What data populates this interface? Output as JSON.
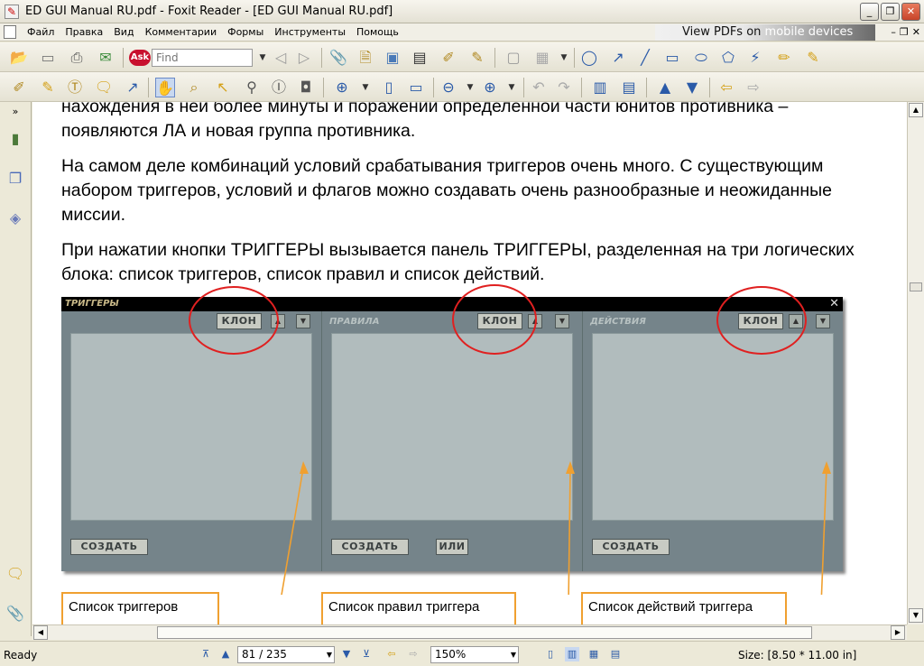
{
  "window": {
    "title": "ED GUI Manual RU.pdf - Foxit Reader - [ED GUI Manual RU.pdf]"
  },
  "menu": {
    "items": [
      "Файл",
      "Правка",
      "Вид",
      "Комментарии",
      "Формы",
      "Инструменты",
      "Помощь"
    ]
  },
  "ad": {
    "text_a": "View PDFs on ",
    "text_b": "mobile devices"
  },
  "toolbar": {
    "find_placeholder": "Find",
    "ask_label": "Ask"
  },
  "document": {
    "paragraphs": [
      "нахождения в ней более минуты и поражении определенной части юнитов противника – появляются ЛА и новая группа противника.",
      "На самом деле комбинаций условий срабатывания триггеров очень много. С существующим набором триггеров, условий и флагов можно создавать очень разнообразные и неожиданные миссии.",
      "При нажатии кнопки ТРИГГЕРЫ вызывается панель ТРИГГЕРЫ, разделенная на три логических блока: список триггеров, список правил и список действий."
    ],
    "panel": {
      "title": "ТРИГГЕРЫ",
      "close": "✕",
      "columns": [
        {
          "title": "",
          "clone": "КЛОН",
          "create": "СОЗДАТЬ",
          "extra": ""
        },
        {
          "title": "ПРАВИЛА",
          "clone": "КЛОН",
          "create": "СОЗДАТЬ",
          "extra": "ИЛИ"
        },
        {
          "title": "ДЕЙСТВИЯ",
          "clone": "КЛОН",
          "create": "СОЗДАТЬ",
          "extra": ""
        }
      ]
    },
    "callouts": [
      "Список триггеров",
      "Список правил триггера",
      "Список действий триггера"
    ]
  },
  "status": {
    "ready": "Ready",
    "page": "81 / 235",
    "zoom": "150%",
    "size": "Size: [8.50 * 11.00 in]"
  },
  "colors": {
    "accent": "#2a5aa8",
    "ring": "#e02020",
    "callout_border": "#f0a030",
    "panel_bg": "#5e6e6e"
  }
}
